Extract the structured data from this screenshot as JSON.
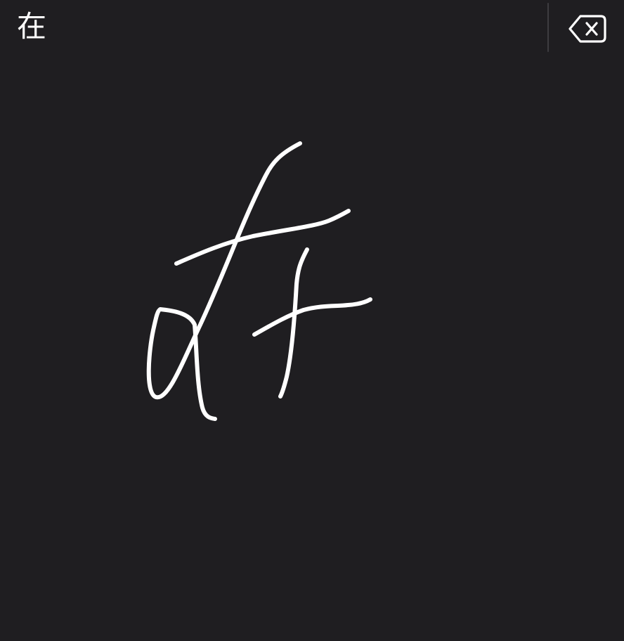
{
  "candidate_bar": {
    "candidates": [
      "在"
    ]
  },
  "delete_button": {
    "icon": "delete-backward-icon"
  },
  "writing_pad": {
    "stroke_color": "#ffffff",
    "background_color": "#1f1e21"
  }
}
